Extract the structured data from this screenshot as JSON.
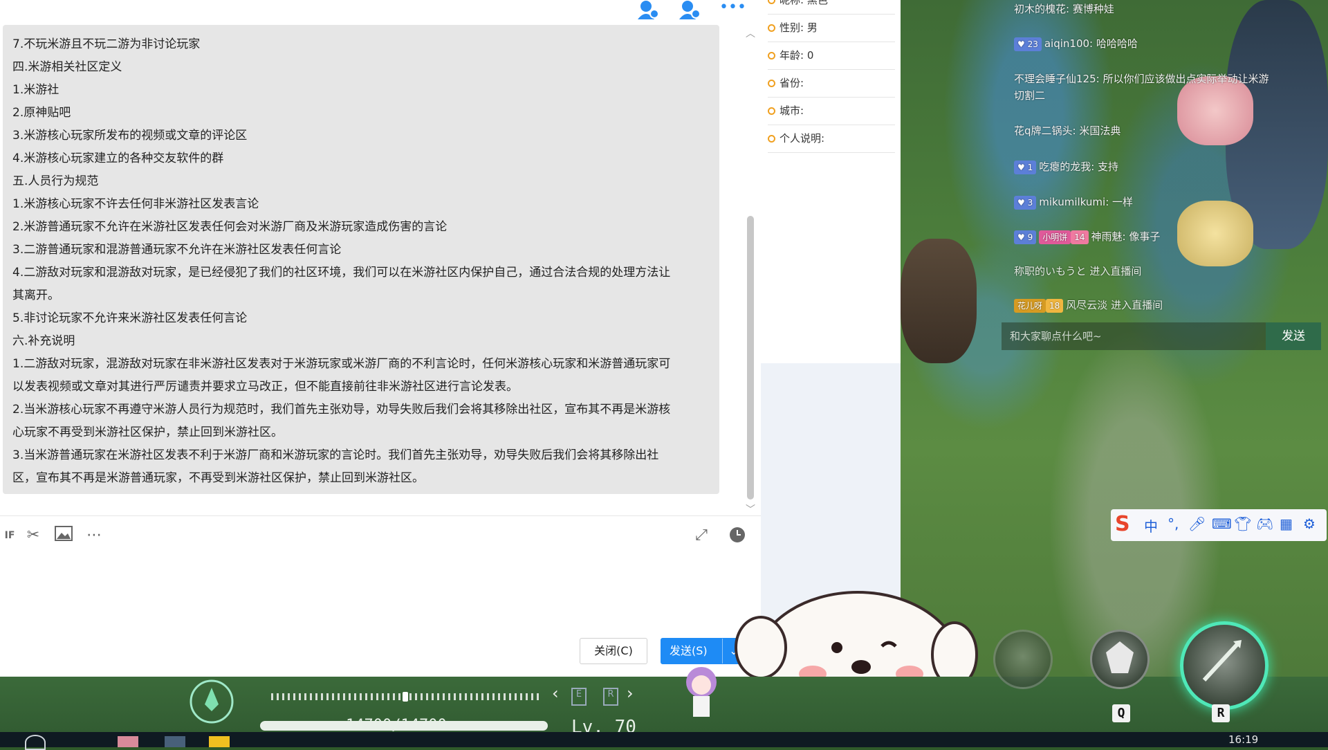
{
  "quote_lines": [
    "7.不玩米游且不玩二游为非讨论玩家",
    "四.米游相关社区定义",
    "1.米游社",
    "2.原神贴吧",
    "3.米游核心玩家所发布的视频或文章的评论区",
    "4.米游核心玩家建立的各种交友软件的群",
    "五.人员行为规范",
    "1.米游核心玩家不许去任何非米游社区发表言论",
    "2.米游普通玩家不允许在米游社区发表任何会对米游厂商及米游玩家造成伤害的言论",
    "3.二游普通玩家和混游普通玩家不允许在米游社区发表任何言论",
    "4.二游敌对玩家和混游敌对玩家，是已经侵犯了我们的社区环境，我们可以在米游社区内保护自己，通过合法合规的处理方法让",
    "其离开。",
    "5.非讨论玩家不允许来米游社区发表任何言论",
    "六.补充说明",
    "1.二游敌对玩家，混游敌对玩家在非米游社区发表对于米游玩家或米游厂商的不利言论时，任何米游核心玩家和米游普通玩家可",
    "以发表视频或文章对其进行严厉谴责并要求立马改正，但不能直接前往非米游社区进行言论发表。",
    "2.当米游核心玩家不再遵守米游人员行为规范时，我们首先主张劝导，劝导失败后我们会将其移除出社区，宣布其不再是米游核",
    "心玩家不再受到米游社区保护，禁止回到米游社区。",
    "3.当米游普通玩家在米游社区发表不利于米游厂商和米游玩家的言论时。我们首先主张劝导，劝导失败后我们会将其移除出社",
    "区，宣布其不再是米游普通玩家，不再受到米游社区保护，禁止回到米游社区。"
  ],
  "buttons": {
    "close": "关闭(C)",
    "send": "发送(S)"
  },
  "profile": {
    "nickname_label": "昵称:",
    "nickname_value": "黑色",
    "gender_label": "性别:",
    "gender_value": "男",
    "age_label": "年龄:",
    "age_value": "0",
    "province_label": "省份:",
    "city_label": "城市:",
    "bio_label": "个人说明:"
  },
  "danmaku": {
    "m1": "初木的槐花: 赛博种娃",
    "m2_level": "23",
    "m2_text": "aiqin100: 哈哈哈哈",
    "m3_line1": "不理会睡子仙125: 所以你们应该做出点实际举动让米游",
    "m3_line2": "切割二",
    "m4": "花q牌二锅头: 米国法典",
    "m5_level": "1",
    "m5_text": "吃瘪的龙我: 支持",
    "m6_level": "3",
    "m6_text": "mikumilkumi: 一样",
    "m7_level": "9",
    "m7_fan": "小明饼",
    "m7_fan_level": "14",
    "m7_text": "神雨魅: 像事子",
    "m8": "称职的いもうと 进入直播间",
    "m9_fan": "花儿呀",
    "m9_fan_level": "18",
    "m9_text": "风尽云淡 进入直播间",
    "input_placeholder": "和大家聊点什么吧~",
    "send": "发送"
  },
  "ime": {
    "mode": "中"
  },
  "hud": {
    "hp": "14700/14700",
    "level": "Lv. 70",
    "key_q": "Q",
    "key_r": "R"
  },
  "taskbar": {
    "time": "16:19"
  }
}
